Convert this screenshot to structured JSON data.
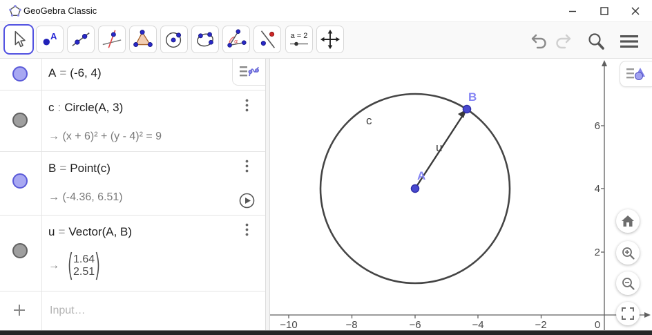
{
  "window": {
    "title": "GeoGebra Classic",
    "controls": [
      "minimize",
      "maximize",
      "close"
    ]
  },
  "toolbar": {
    "tools": [
      {
        "name": "move",
        "selected": true
      },
      {
        "name": "point",
        "icon_label": "A"
      },
      {
        "name": "line"
      },
      {
        "name": "perpendicular-line"
      },
      {
        "name": "polygon"
      },
      {
        "name": "circle-with-center"
      },
      {
        "name": "conic-through-points"
      },
      {
        "name": "angle",
        "icon_label": "α"
      },
      {
        "name": "reflect-about-line"
      },
      {
        "name": "slider",
        "icon_label": "a = 2"
      },
      {
        "name": "move-graphics-view"
      }
    ],
    "actions": [
      "undo-icon",
      "redo-icon",
      "search-icon",
      "menu-icon"
    ]
  },
  "algebra": {
    "rows": [
      {
        "label": "A",
        "relation": "=",
        "definition": "(-6, 4)",
        "toggle": "purple"
      },
      {
        "label": "c",
        "relation": ":",
        "definition": "Circle(A, 3)",
        "output": "→  (x + 6)² + (y - 4)² = 9",
        "toggle": "gray"
      },
      {
        "label": "B",
        "relation": "=",
        "definition": "Point(c)",
        "output": "→  (-4.36, 6.51)",
        "toggle": "purple",
        "has_play": true
      },
      {
        "label": "u",
        "relation": "=",
        "definition": "Vector(A, B)",
        "output_arrow": "→",
        "vector": [
          "1.64",
          "2.51"
        ],
        "toggle": "gray"
      }
    ],
    "input_placeholder": "Input…"
  },
  "graphics": {
    "xticks": [
      {
        "label": "−10",
        "value": -10
      },
      {
        "label": "−8",
        "value": -8
      },
      {
        "label": "−6",
        "value": -6
      },
      {
        "label": "−4",
        "value": -4
      },
      {
        "label": "−2",
        "value": -2
      }
    ],
    "yticks": [
      {
        "label": "6",
        "value": 6
      },
      {
        "label": "4",
        "value": 4
      },
      {
        "label": "2",
        "value": 2
      }
    ],
    "origin_label": "0",
    "objects": {
      "points": [
        {
          "name": "A",
          "x": -6,
          "y": 4
        },
        {
          "name": "B",
          "x": -4.36,
          "y": 6.51
        }
      ],
      "circle": {
        "name": "c",
        "center": "A",
        "radius": 3
      },
      "vector": {
        "name": "u",
        "from": "A",
        "to": "B"
      }
    }
  },
  "colors": {
    "accent_blue": "#5151e1",
    "point_fill": "#4949cf",
    "point_label": "#8585f4",
    "object_stroke": "#454545",
    "toggle_purple": "#a8a8f2",
    "toggle_gray": "#9f9f9f",
    "output_gray": "#7a7a7a",
    "angle_red": "#e05555",
    "polygon_fill": "#f2cdb2"
  },
  "icons": [
    "geogebra-logo",
    "minimize-icon",
    "maximize-icon",
    "close-icon",
    "undo-icon",
    "redo-icon",
    "search-icon",
    "menu-icon",
    "algebra-style-icon",
    "kebab-menu-icon",
    "play-icon",
    "plus-icon",
    "graphics-style-icon",
    "home-icon",
    "zoom-in-icon",
    "zoom-out-icon",
    "fullscreen-icon"
  ]
}
